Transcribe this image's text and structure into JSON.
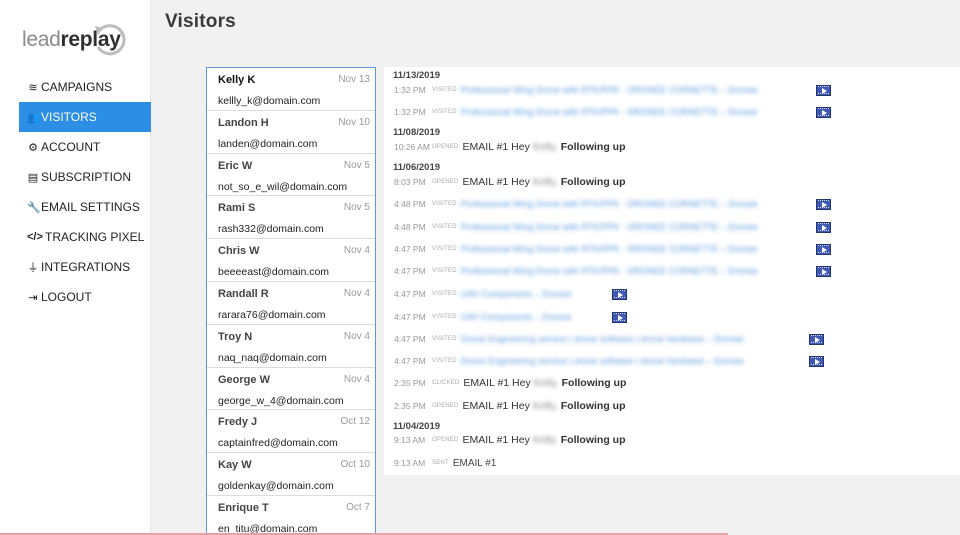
{
  "logo": {
    "part1": "lead",
    "part2": "replay"
  },
  "page_title": "Visitors",
  "nav": [
    {
      "icon": "layers-icon",
      "label": "CAMPAIGNS"
    },
    {
      "icon": "users-icon",
      "label": "VISITORS",
      "active": true
    },
    {
      "icon": "gear-icon",
      "label": "ACCOUNT"
    },
    {
      "icon": "receipt-icon",
      "label": "SUBSCRIPTION"
    },
    {
      "icon": "wrench-icon",
      "label": "EMAIL SETTINGS"
    },
    {
      "icon": "code-icon",
      "label": "TRACKING PIXEL"
    },
    {
      "icon": "plug-icon",
      "label": "INTEGRATIONS"
    },
    {
      "icon": "logout-icon",
      "label": "LOGOUT"
    }
  ],
  "visitors": [
    {
      "name": "Kelly K",
      "date": "Nov 13",
      "email": "kellly_k@domain.com"
    },
    {
      "name": "Landon H",
      "date": "Nov 10",
      "email": "landen@domain.com"
    },
    {
      "name": "Eric W",
      "date": "Nov 5",
      "email": "not_so_e_wil@domain.com"
    },
    {
      "name": "Rami S",
      "date": "Nov 5",
      "email": "rash332@domain.com"
    },
    {
      "name": "Chris W",
      "date": "Nov 4",
      "email": "beeeeast@domain.com"
    },
    {
      "name": "Randall R",
      "date": "Nov 4",
      "email": "rarara76@domain.com"
    },
    {
      "name": "Troy N",
      "date": "Nov 4",
      "email": "naq_naq@domain.com"
    },
    {
      "name": "George W",
      "date": "Nov 4",
      "email": "george_w_4@domain.com"
    },
    {
      "name": "Fredy J",
      "date": "Oct 12",
      "email": "captainfred@domain.com"
    },
    {
      "name": "Kay W",
      "date": "Oct 10",
      "email": "goldenkay@domain.com"
    },
    {
      "name": "Enrique T",
      "date": "Oct 7",
      "email": "en_titu@domain.com"
    }
  ],
  "activity": {
    "dates": [
      "11/13/2019",
      "11/08/2019",
      "11/06/2019",
      "11/04/2019"
    ],
    "rows": [
      {
        "time": "1:32 PM",
        "action": "VISITED",
        "page": "Professional Wing Drone with RTK/PPK - DRONEE CORNETTE – Dronee",
        "video": true
      },
      {
        "time": "1:32 PM",
        "action": "VISITED",
        "page": "Professional Wing Drone with RTK/PPK - DRONEE CORNETTE – Dronee",
        "video": true
      },
      {
        "time": "10:26 AM",
        "action": "OPENED",
        "email": "EMAIL #1 Hey",
        "name": "Kelly,",
        "rest": "Following up"
      },
      {
        "time": "8:03 PM",
        "action": "OPENED",
        "email": "EMAIL #1 Hey",
        "name": "Kelly,",
        "rest": "Following up"
      },
      {
        "time": "4:48 PM",
        "action": "VISITED",
        "page": "Professional Wing Drone with RTK/PPK - DRONEE CORNETTE – Dronee",
        "video": true
      },
      {
        "time": "4:48 PM",
        "action": "VISITED",
        "page": "Professional Wing Drone with RTK/PPK - DRONEE CORNETTE – Dronee",
        "video": true
      },
      {
        "time": "4:47 PM",
        "action": "VISITED",
        "page": "Professional Wing Drone with RTK/PPK - DRONEE CORNETTE – Dronee",
        "video": true
      },
      {
        "time": "4:47 PM",
        "action": "VISITED",
        "page": "Professional Wing Drone with RTK/PPK - DRONEE CORNETTE – Dronee",
        "video": true
      },
      {
        "time": "4:47 PM",
        "action": "VISITED",
        "page": "UAV Components – Dronee",
        "video": true
      },
      {
        "time": "4:47 PM",
        "action": "VISITED",
        "page": "UAV Components – Dronee",
        "video": true
      },
      {
        "time": "4:47 PM",
        "action": "VISITED",
        "page": "Drone Engineering service | drone software | drone hardware – Dronee",
        "video": true
      },
      {
        "time": "4:47 PM",
        "action": "VISITED",
        "page": "Drone Engineering service | drone software | drone hardware – Dronee",
        "video": true
      },
      {
        "time": "2:35 PM",
        "action": "CLICKED",
        "email": "EMAIL #1 Hey",
        "name": "Kelly,",
        "rest": "Following up"
      },
      {
        "time": "2:35 PM",
        "action": "OPENED",
        "email": "EMAIL #1 Hey",
        "name": "Kelly,",
        "rest": "Following up"
      },
      {
        "time": "9:13 AM",
        "action": "OPENED",
        "email": "EMAIL #1 Hey",
        "name": "Kelly,",
        "rest": "Following up"
      },
      {
        "time": "9:13 AM",
        "action": "SENT",
        "email": "EMAIL #1"
      }
    ]
  }
}
